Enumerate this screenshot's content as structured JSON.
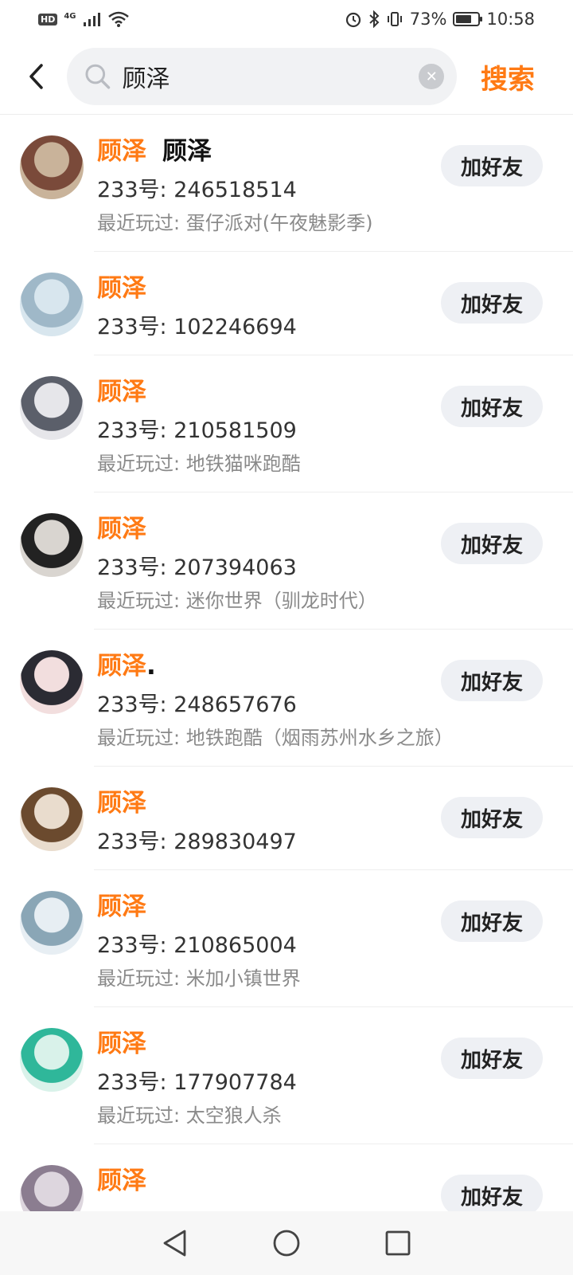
{
  "status_bar": {
    "hd": "HD",
    "network": "4G",
    "battery_text": "73%",
    "battery_level": 0.73,
    "time": "10:58"
  },
  "search": {
    "query": "顾泽",
    "button_label": "搜索"
  },
  "results": [
    {
      "name": "顾泽",
      "suffix": "顾泽",
      "uid": "233号: 246518514",
      "recent": "最近玩过: 蛋仔派对(午夜魅影季)",
      "add_label": "加好友",
      "avatar_colors": [
        "#c9b39a",
        "#7a4a3a"
      ]
    },
    {
      "name": "顾泽",
      "suffix": "",
      "uid": "233号: 102246694",
      "recent": "",
      "add_label": "加好友",
      "avatar_colors": [
        "#d8e6ee",
        "#9fb8c8"
      ]
    },
    {
      "name": "顾泽",
      "suffix": "",
      "uid": "233号: 210581509",
      "recent": "最近玩过: 地铁猫咪跑酷",
      "add_label": "加好友",
      "avatar_colors": [
        "#e6e6ea",
        "#5b5f6a"
      ]
    },
    {
      "name": "顾泽",
      "suffix": "",
      "uid": "233号: 207394063",
      "recent": "最近玩过: 迷你世界（驯龙时代）",
      "add_label": "加好友",
      "avatar_colors": [
        "#d9d5d0",
        "#222222"
      ]
    },
    {
      "name": "顾泽",
      "suffix": ".",
      "uid": "233号: 248657676",
      "recent": "最近玩过: 地铁跑酷（烟雨苏州水乡之旅）",
      "add_label": "加好友",
      "avatar_colors": [
        "#f2dede",
        "#2b2b33"
      ]
    },
    {
      "name": "顾泽",
      "suffix": "",
      "uid": "233号: 289830497",
      "recent": "",
      "add_label": "加好友",
      "avatar_colors": [
        "#e9dccd",
        "#6b4a2e"
      ]
    },
    {
      "name": "顾泽",
      "suffix": "",
      "uid": "233号: 210865004",
      "recent": "最近玩过: 米加小镇世界",
      "add_label": "加好友",
      "avatar_colors": [
        "#e7eef3",
        "#8aa6b6"
      ]
    },
    {
      "name": "顾泽",
      "suffix": "",
      "uid": "233号: 177907784",
      "recent": "最近玩过: 太空狼人杀",
      "add_label": "加好友",
      "avatar_colors": [
        "#d9f2ea",
        "#2fb79a"
      ]
    },
    {
      "name": "顾泽",
      "suffix": "",
      "uid": "",
      "recent": "",
      "add_label": "加好友",
      "avatar_colors": [
        "#ddd6de",
        "#8b7d90"
      ]
    }
  ]
}
